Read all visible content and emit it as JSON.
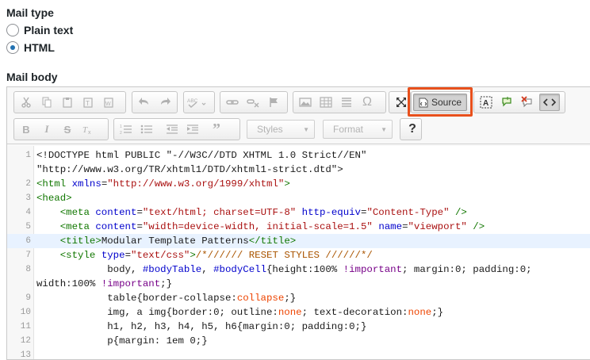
{
  "mail_type": {
    "label": "Mail type",
    "options": [
      {
        "label": "Plain text",
        "checked": false
      },
      {
        "label": "HTML",
        "checked": true
      }
    ]
  },
  "mail_body": {
    "label": "Mail body"
  },
  "toolbar": {
    "source_label": "Source",
    "styles_label": "Styles",
    "format_label": "Format",
    "help_label": "?"
  },
  "code": {
    "active_line": 6,
    "lines": [
      {
        "num": "1",
        "segments": [
          {
            "t": "<!DOCTYPE html PUBLIC \"-//W3C//DTD XHTML 1.0 Strict//EN\"",
            "c": ""
          }
        ]
      },
      {
        "num": "",
        "segments": [
          {
            "t": "\"http://www.w3.org/TR/xhtml1/DTD/xhtml1-strict.dtd\">",
            "c": ""
          }
        ]
      },
      {
        "num": "2",
        "segments": [
          {
            "t": "<html ",
            "c": "t-tag"
          },
          {
            "t": "xmlns",
            "c": "t-attr"
          },
          {
            "t": "=",
            "c": ""
          },
          {
            "t": "\"http://www.w3.org/1999/xhtml\"",
            "c": "t-str"
          },
          {
            "t": ">",
            "c": "t-tag"
          }
        ]
      },
      {
        "num": "3",
        "segments": [
          {
            "t": "<head>",
            "c": "t-tag"
          }
        ]
      },
      {
        "num": "4",
        "segments": [
          {
            "t": "    ",
            "c": ""
          },
          {
            "t": "<meta ",
            "c": "t-tag"
          },
          {
            "t": "content",
            "c": "t-attr"
          },
          {
            "t": "=",
            "c": ""
          },
          {
            "t": "\"text/html; charset=UTF-8\"",
            "c": "t-str"
          },
          {
            "t": " ",
            "c": ""
          },
          {
            "t": "http-equiv",
            "c": "t-attr"
          },
          {
            "t": "=",
            "c": ""
          },
          {
            "t": "\"Content-Type\"",
            "c": "t-str"
          },
          {
            "t": " />",
            "c": "t-tag"
          }
        ]
      },
      {
        "num": "5",
        "segments": [
          {
            "t": "    ",
            "c": ""
          },
          {
            "t": "<meta ",
            "c": "t-tag"
          },
          {
            "t": "content",
            "c": "t-attr"
          },
          {
            "t": "=",
            "c": ""
          },
          {
            "t": "\"width=device-width, initial-scale=1.5\"",
            "c": "t-str"
          },
          {
            "t": " ",
            "c": ""
          },
          {
            "t": "name",
            "c": "t-attr"
          },
          {
            "t": "=",
            "c": ""
          },
          {
            "t": "\"viewport\"",
            "c": "t-str"
          },
          {
            "t": " />",
            "c": "t-tag"
          }
        ]
      },
      {
        "num": "6",
        "segments": [
          {
            "t": "    ",
            "c": ""
          },
          {
            "t": "<title>",
            "c": "t-tag"
          },
          {
            "t": "Modular Template Patterns",
            "c": ""
          },
          {
            "t": "</title>",
            "c": "t-tag"
          }
        ]
      },
      {
        "num": "7",
        "segments": [
          {
            "t": "    ",
            "c": ""
          },
          {
            "t": "<style ",
            "c": "t-tag"
          },
          {
            "t": "type",
            "c": "t-attr"
          },
          {
            "t": "=",
            "c": ""
          },
          {
            "t": "\"text/css\"",
            "c": "t-str"
          },
          {
            "t": ">",
            "c": "t-tag"
          },
          {
            "t": "/*////// RESET STYLES //////*/",
            "c": "t-com"
          }
        ]
      },
      {
        "num": "8",
        "segments": [
          {
            "t": "            body, ",
            "c": ""
          },
          {
            "t": "#bodyTable",
            "c": "t-attr"
          },
          {
            "t": ", ",
            "c": ""
          },
          {
            "t": "#bodyCell",
            "c": "t-attr"
          },
          {
            "t": "{height:100% ",
            "c": ""
          },
          {
            "t": "!important",
            "c": "t-imp"
          },
          {
            "t": "; margin:0; padding:0;",
            "c": ""
          }
        ]
      },
      {
        "num": "",
        "segments": [
          {
            "t": "width:100% ",
            "c": ""
          },
          {
            "t": "!important",
            "c": "t-imp"
          },
          {
            "t": ";}",
            "c": ""
          }
        ]
      },
      {
        "num": "9",
        "segments": [
          {
            "t": "            table{border-collapse:",
            "c": ""
          },
          {
            "t": "collapse",
            "c": "t-kw"
          },
          {
            "t": ";}",
            "c": ""
          }
        ]
      },
      {
        "num": "10",
        "segments": [
          {
            "t": "            img, a img{border:0; outline:",
            "c": ""
          },
          {
            "t": "none",
            "c": "t-kw"
          },
          {
            "t": "; text-decoration:",
            "c": ""
          },
          {
            "t": "none",
            "c": "t-kw"
          },
          {
            "t": ";}",
            "c": ""
          }
        ]
      },
      {
        "num": "11",
        "segments": [
          {
            "t": "            h1, h2, h3, h4, h5, h6{margin:0; padding:0;}",
            "c": ""
          }
        ]
      },
      {
        "num": "12",
        "segments": [
          {
            "t": "            p{margin: 1em 0;}",
            "c": ""
          }
        ]
      },
      {
        "num": "13",
        "segments": [
          {
            "t": "",
            "c": ""
          }
        ]
      }
    ]
  },
  "colors": {
    "highlight_border": "#e8501c",
    "radio_checked": "#2271b1",
    "active_line_bg": "#e8f2ff"
  }
}
